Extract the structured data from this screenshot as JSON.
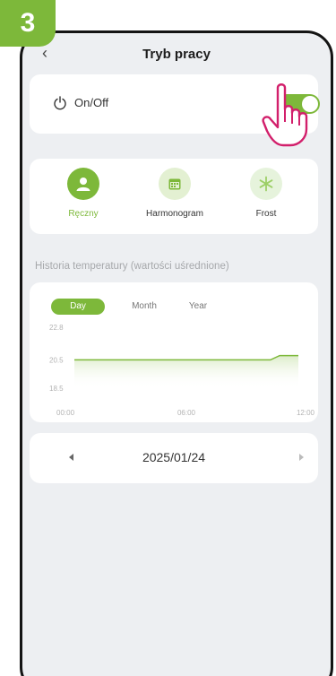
{
  "step_number": "3",
  "header": {
    "title": "Tryb pracy"
  },
  "power": {
    "label": "On/Off",
    "toggle_on": true
  },
  "modes": [
    {
      "label": "Ręczny",
      "icon": "person-icon",
      "active": true
    },
    {
      "label": "Harmonogram",
      "icon": "calendar-icon",
      "active": false
    },
    {
      "label": "Frost",
      "icon": "snowflake-icon",
      "active": false
    }
  ],
  "history": {
    "title": "Historia temperatury (wartości uśrednione)"
  },
  "chart_tabs": [
    "Day",
    "Month",
    "Year"
  ],
  "chart_data": {
    "type": "area",
    "x_labels": [
      "00:00",
      "06:00",
      "12:00"
    ],
    "y_ticks": [
      "22.8",
      "20.5",
      "18.5"
    ],
    "ylim": [
      18.5,
      22.8
    ],
    "series": [
      {
        "x": [
          "00:00",
          "10:30",
          "11:00",
          "12:00"
        ],
        "values": [
          20.5,
          20.5,
          20.8,
          20.8
        ]
      }
    ]
  },
  "date_nav": {
    "date": "2025/01/24"
  },
  "colors": {
    "accent": "#7db83a",
    "background": "#edeff2",
    "card": "#ffffff",
    "hand": "#d21f6b"
  }
}
